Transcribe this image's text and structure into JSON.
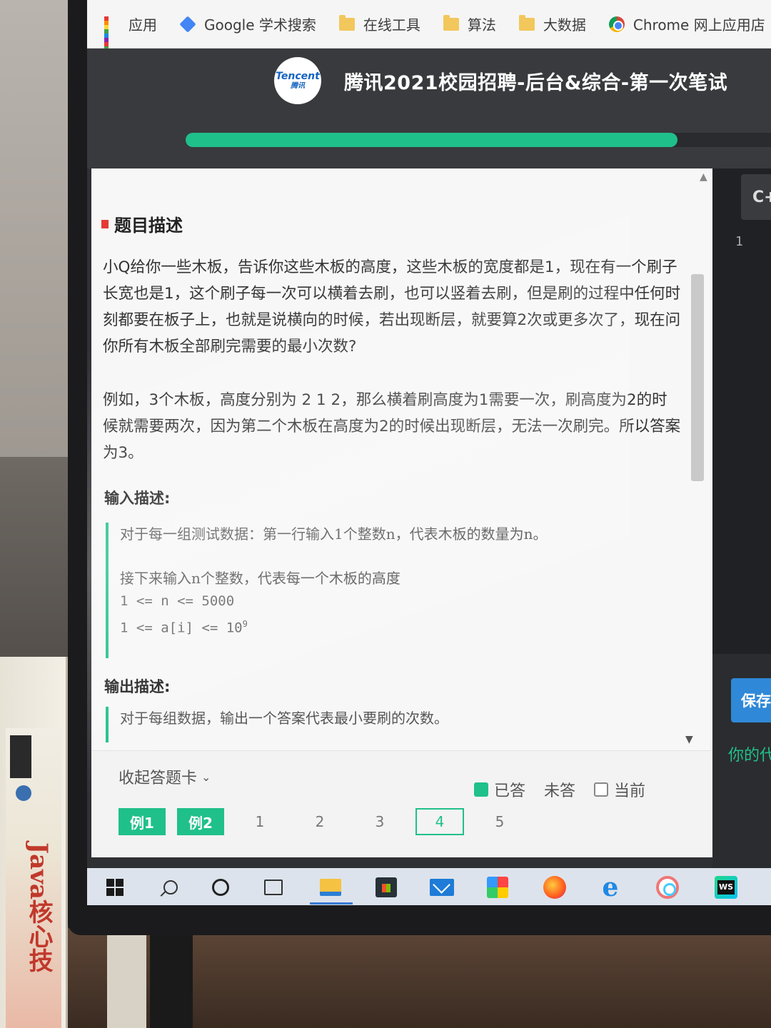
{
  "bookmarks": [
    {
      "label": "应用",
      "icon": "apps-icon"
    },
    {
      "label": "Google 学术搜索",
      "icon": "google-scholar-icon"
    },
    {
      "label": "在线工具",
      "icon": "folder-icon"
    },
    {
      "label": "算法",
      "icon": "folder-icon"
    },
    {
      "label": "大数据",
      "icon": "folder-icon"
    },
    {
      "label": "Chrome 网上应用店",
      "icon": "chrome-icon"
    }
  ],
  "header": {
    "logo_line1": "Tencent",
    "logo_line2": "腾讯",
    "title": "腾讯2021校园招聘-后台&综合-第一次笔试"
  },
  "progress": {
    "fraction": 0.82,
    "color": "#20c08a"
  },
  "question": {
    "section_title": "题目描述",
    "paragraph1": "小Q给你一些木板，告诉你这些木板的高度，这些木板的宽度都是1，现在有一个刷子长宽也是1，这个刷子每一次可以横着去刷，也可以竖着去刷，但是刷的过程中任何时刻都要在板子上，也就是说横向的时候，若出现断层，就要算2次或更多次了，现在问你所有木板全部刷完需要的最小次数?",
    "paragraph2": "例如，3个木板，高度分别为 2 1 2，那么横着刷高度为1需要一次，刷高度为2的时候就需要两次，因为第二个木板在高度为2的时候出现断层，无法一次刷完。所以答案为3。",
    "input_title": "输入描述:",
    "input_line1": "对于每一组测试数据：第一行输入1个整数n，代表木板的数量为n。",
    "input_line2": "接下来输入n个整数，代表每一个木板的高度",
    "input_line3": "1 <= n <= 5000",
    "input_line4_prefix": "1 <= a[i] <= 10",
    "input_line4_sup": "9",
    "output_title": "输出描述:",
    "output_line1": "对于每组数据，输出一个答案代表最小要刷的次数。"
  },
  "answer_card": {
    "collapse_label": "收起答题卡",
    "legend_answered": "已答",
    "legend_unanswered": "未答",
    "legend_current": "当前",
    "buttons": [
      "例1",
      "例2",
      "1",
      "2",
      "3",
      "4",
      "5"
    ]
  },
  "editor": {
    "language_tab": "C+",
    "line_number": "1",
    "save_label": "保存",
    "your_code_label": "你的代码"
  },
  "book": {
    "title": "Java核心技"
  }
}
